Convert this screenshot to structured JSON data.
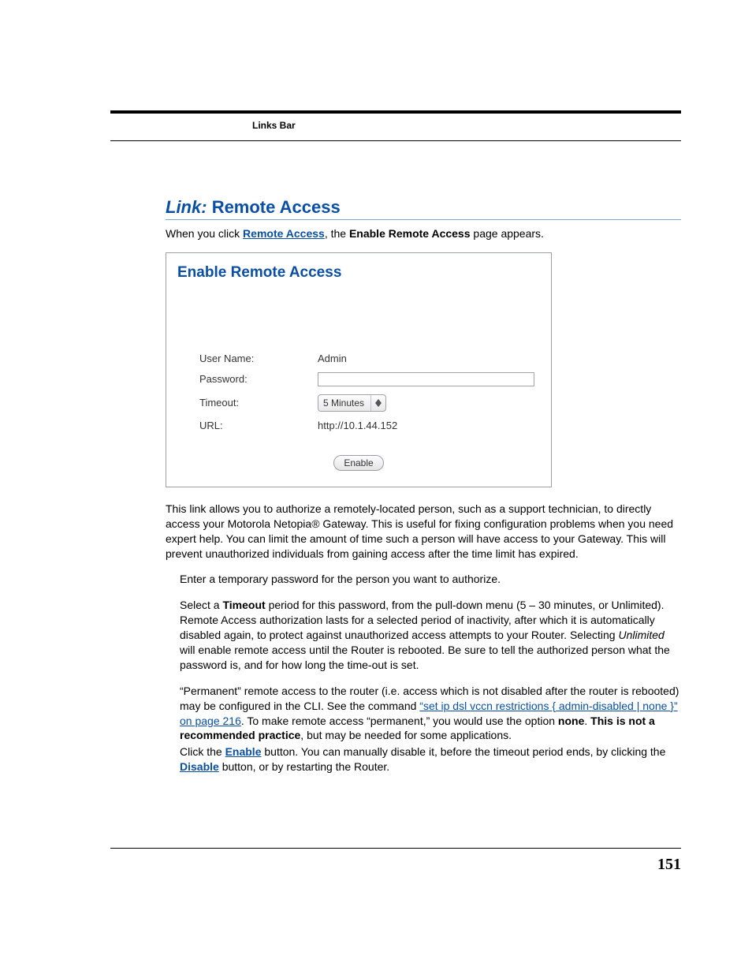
{
  "header": {
    "links_bar": "Links Bar"
  },
  "section": {
    "prefix": "Link:",
    "title": "Remote Access"
  },
  "lead": {
    "before": "When you click ",
    "link": "Remote Access",
    "mid": ", the ",
    "bold": "Enable Remote Access",
    "after": " page appears."
  },
  "screenshot": {
    "title": "Enable Remote Access",
    "rows": {
      "username_label": "User Name:",
      "username_value": "Admin",
      "password_label": "Password:",
      "password_value": "",
      "timeout_label": "Timeout:",
      "timeout_selected": "5 Minutes",
      "url_label": "URL:",
      "url_value": "http://10.1.44.152"
    },
    "enable_button": "Enable"
  },
  "para1": "This link allows you to authorize a remotely-located person, such as a support technician, to directly access your Motorola Netopia® Gateway. This is useful for fixing configuration problems when you need expert help. You can limit the amount of time such a person will have access to your Gateway. This will prevent unauthorized individuals from gaining access after the time limit has expired.",
  "step1": "Enter a temporary password for the person you want to authorize.",
  "step2": {
    "a": "Select a ",
    "bold1": "Timeout",
    "b": " period for this password, from the pull-down menu (5 – 30 minutes, or Unlimited). Remote Access authorization lasts for a selected period of inactivity, after which it is automatically disabled again, to protect against unauthorized access attempts to your Router. Selecting ",
    "ital": "Unlimited",
    "c": " will enable remote access until the Router is rebooted. Be sure to tell the authorized person what the password is, and for how long the time-out is set."
  },
  "step3": {
    "a": "“Permanent” remote access to the router (i.e. access which is not disabled after the router is rebooted) may be configured in the CLI. See the command ",
    "link1": "“set ip dsl vccn restrictions { admin-disabled | none }” on page 216",
    "b": ". To make remote access “permanent,” you would use the option ",
    "bold_none": "none",
    "c": ". ",
    "bold_warn": "This is not a recommended practice",
    "d": ", but may be needed for some applications."
  },
  "step4": {
    "a": "Click the ",
    "link_enable": "Enable",
    "b": " button. You can manually disable it, before the timeout period ends, by clicking the ",
    "link_disable": "Disable",
    "c": " button, or by restarting the Router."
  },
  "page_number": "151"
}
